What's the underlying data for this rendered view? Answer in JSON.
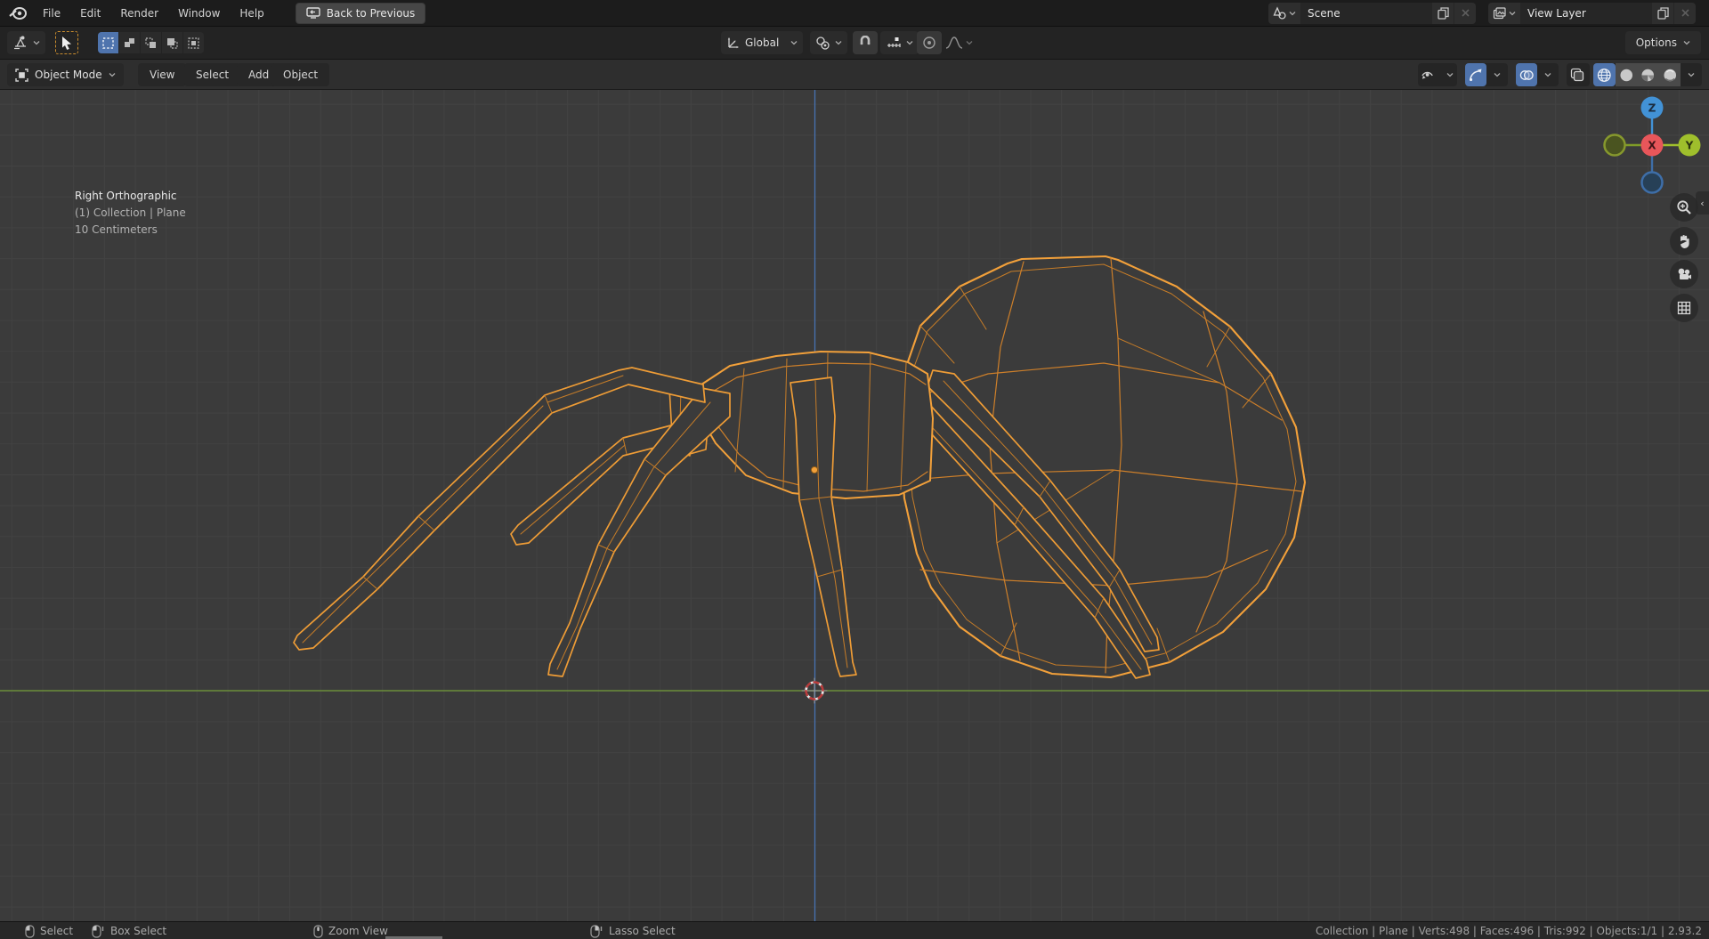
{
  "menu_bar": {
    "items": [
      "File",
      "Edit",
      "Render",
      "Window",
      "Help"
    ],
    "back_label": "Back to Previous",
    "scene_value": "Scene",
    "view_layer_value": "View Layer"
  },
  "tool_settings": {
    "orientation_label": "Global",
    "options_label": "Options"
  },
  "viewport_header": {
    "mode_label": "Object Mode",
    "menus": [
      "View",
      "Select",
      "Add",
      "Object"
    ]
  },
  "viewport_overlay": {
    "line1": "Right Orthographic",
    "line2": "(1) Collection | Plane",
    "line3": "10 Centimeters"
  },
  "gizmo": {
    "x": "X",
    "y": "Y",
    "z": "Z"
  },
  "status_bar": {
    "items": [
      "Select",
      "Box Select",
      "Zoom View",
      "Lasso Select"
    ],
    "stats": "Collection | Plane | Verts:498 | Faces:496 | Tris:992 | Objects:1/1 | 2.93.2"
  },
  "colors": {
    "accent_blue": "#4f74ad",
    "wire_orange": "#cd7f2a",
    "wire_bright": "#f2a03a",
    "axis_green": "#6b8e3a",
    "axis_blue": "#4772b3",
    "gizmo_x_red": "#e8565a",
    "gizmo_y_green": "#9fbf2c",
    "gizmo_z_blue": "#4292d6"
  }
}
